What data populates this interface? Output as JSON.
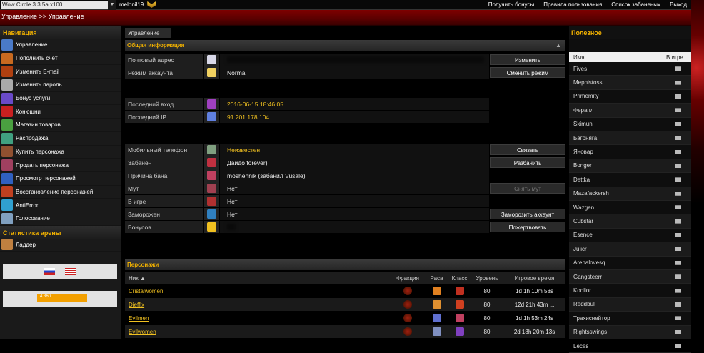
{
  "topbar": {
    "realm": "Wow Circle 3.3.5a x100",
    "account": "melonil19",
    "links": [
      "Получить бонусы",
      "Правила пользования",
      "Список забаненых",
      "Выход"
    ]
  },
  "header": {
    "breadcrumb": "Управление >> Управление"
  },
  "sidebar": {
    "nav_title": "Навигация",
    "items": [
      {
        "label": "Управление",
        "icon": "control-icon",
        "color": "#4a7ac8"
      },
      {
        "label": "Пополнить счёт",
        "icon": "coins-icon",
        "color": "#c86a20"
      },
      {
        "label": "Изменить E-mail",
        "icon": "fire-icon",
        "color": "#b04010"
      },
      {
        "label": "Изменить пароль",
        "icon": "skull-icon",
        "color": "#aaaaaa"
      },
      {
        "label": "Бонус услуги",
        "icon": "bonus-icon",
        "color": "#6a4ac8"
      },
      {
        "label": "Конюшни",
        "icon": "mount-icon",
        "color": "#c82020"
      },
      {
        "label": "Магазин товаров",
        "icon": "shop-icon",
        "color": "#4aa040"
      },
      {
        "label": "Распродажа",
        "icon": "sale-icon",
        "color": "#40a080"
      },
      {
        "label": "Купить персонажа",
        "icon": "buy-char-icon",
        "color": "#905030"
      },
      {
        "label": "Продать персонажа",
        "icon": "sell-char-icon",
        "color": "#a04060"
      },
      {
        "label": "Просмотр персонажей",
        "icon": "view-chars-icon",
        "color": "#3060c0"
      },
      {
        "label": "Восстановление персонажей",
        "icon": "restore-icon",
        "color": "#c04020"
      },
      {
        "label": "AntiError",
        "icon": "antierror-icon",
        "color": "#30a0d0"
      },
      {
        "label": "Голосование",
        "icon": "vote-icon",
        "color": "#80a0c0"
      }
    ],
    "arena_title": "Статистика арены",
    "ladder": {
      "label": "Ладдер",
      "icon": "ladder-icon",
      "color": "#c08040"
    },
    "counter": "4 360"
  },
  "main": {
    "tab": "Управление",
    "general_title": "Общая информация",
    "rows_a": [
      {
        "label": "Почтовый адрес",
        "value": "",
        "icon": "mail-icon",
        "color": "#d8d8e8",
        "button": "Изменить"
      },
      {
        "label": "Режим аккаунта",
        "value": "Normal",
        "icon": "star-icon",
        "color": "#f0d060",
        "button": "Сменить режим"
      }
    ],
    "rows_b": [
      {
        "label": "Последний вход",
        "value": "2016-06-15 18:46:05",
        "icon": "clock-icon",
        "color": "#a040c0"
      },
      {
        "label": "Последний IP",
        "value": "91.201.178.104",
        "icon": "network-icon",
        "color": "#6080e0"
      }
    ],
    "rows_c": [
      {
        "label": "Мобильный телефон",
        "value": "Неизвестен",
        "icon": "phone-icon",
        "color": "#80a080",
        "button": "Связать",
        "gold": true
      },
      {
        "label": "Забанен",
        "value": "Даидо forever)",
        "icon": "ban-icon",
        "color": "#c03040",
        "button": "Разбанить"
      },
      {
        "label": "Причина бана",
        "value": "moshennik (забанил Vusale)",
        "icon": "reason-icon",
        "color": "#c04060"
      },
      {
        "label": "Мут",
        "value": "Нет",
        "icon": "mute-icon",
        "color": "#a04050",
        "button": "Снять мут",
        "disabled": true
      },
      {
        "label": "В игре",
        "value": "Нет",
        "icon": "ingame-icon",
        "color": "#b03030"
      },
      {
        "label": "Заморожен",
        "value": "Нет",
        "icon": "frozen-icon",
        "color": "#3080c0",
        "button": "Заморозить аккаунт"
      },
      {
        "label": "Бонусов",
        "value": "",
        "icon": "bonus-coin-icon",
        "color": "#f0c020",
        "button": "Пожертвовать"
      }
    ],
    "chars_title": "Персонажи",
    "char_headers": {
      "nick": "Ник ▲",
      "faction": "Фракция",
      "race": "Раса",
      "class": "Класс",
      "level": "Уровень",
      "time": "Игровое время"
    },
    "characters": [
      {
        "nick": "Cristalwomen",
        "level": "80",
        "time": "1d 1h 10m 58s",
        "race": "#e08020",
        "class": "#c03020"
      },
      {
        "nick": "Dieffix",
        "level": "80",
        "time": "12d 21h 43m ...",
        "race": "#e09030",
        "class": "#d04020"
      },
      {
        "nick": "Evilmen",
        "level": "80",
        "time": "1d 1h 53m 24s",
        "race": "#6070d0",
        "class": "#c04060"
      },
      {
        "nick": "Evilwomen",
        "level": "80",
        "time": "2d 18h 20m 13s",
        "race": "#8090c0",
        "class": "#8040c0"
      }
    ]
  },
  "useful": {
    "title": "Полезное",
    "col_name": "Имя",
    "col_ingame": "В игре",
    "players": [
      "Fives",
      "Mephistoss",
      "Primemity",
      "Ферапл",
      "Skimun",
      "Бaгoнягa",
      "Янoвaр",
      "Bonger",
      "Dettka",
      "Mazafackersh",
      "Wazgen",
      "Cubstar",
      "Esence",
      "Julicr",
      "Arenalovesq",
      "Gangsteerr",
      "Koollor",
      "Reddbull",
      "Трахиснейтор",
      "Rightsswings",
      "Leces"
    ]
  }
}
